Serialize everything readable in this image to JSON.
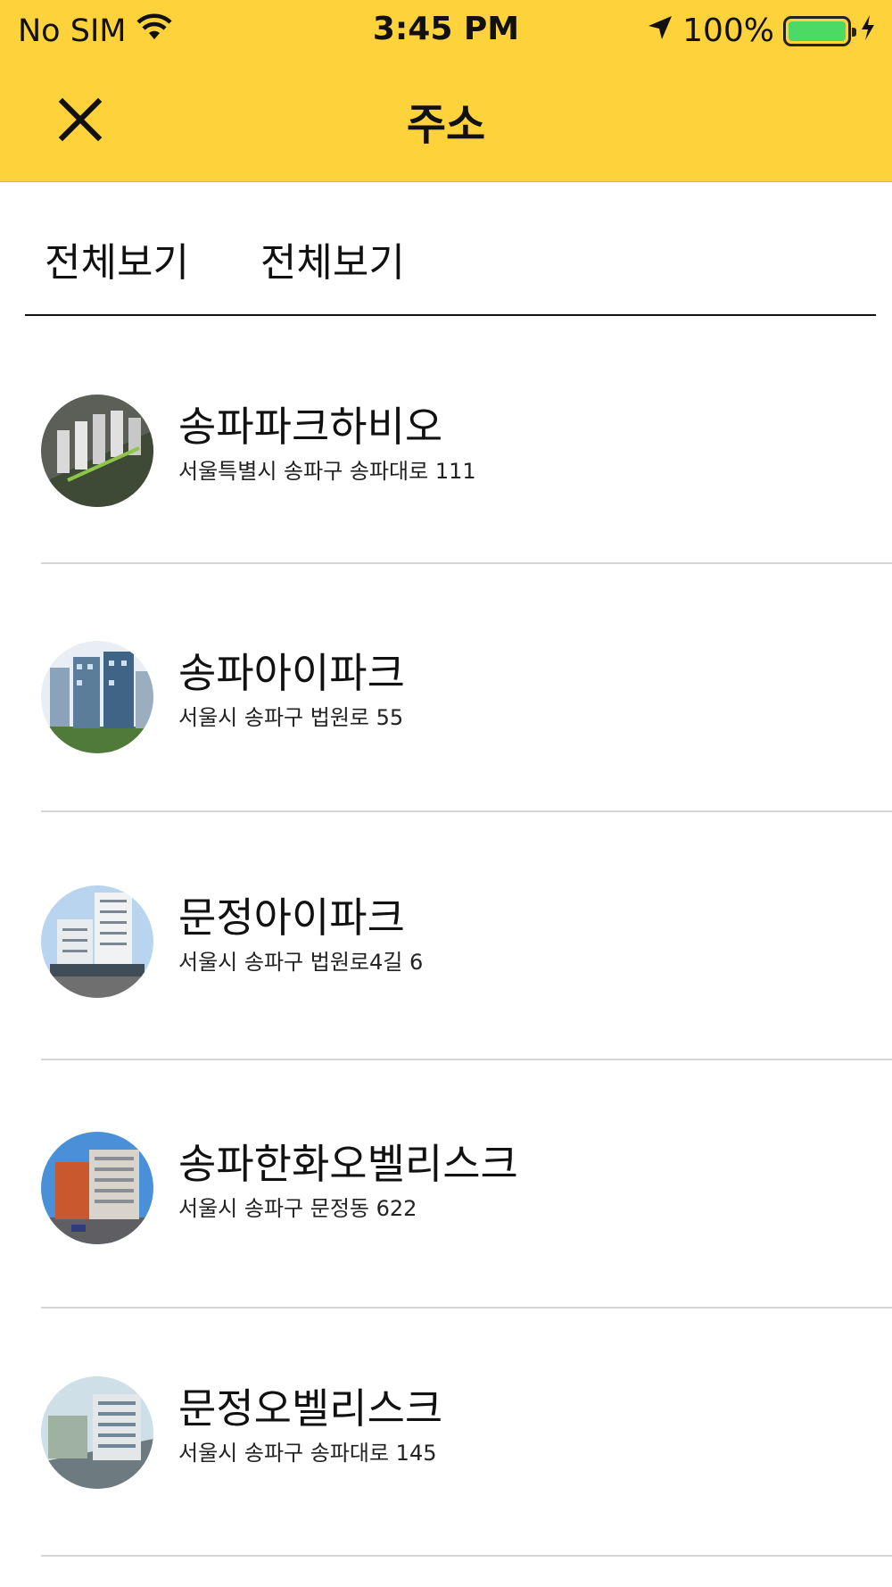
{
  "status_bar": {
    "carrier": "No SIM",
    "time": "3:45 PM",
    "battery": "100%"
  },
  "header": {
    "title": "주소",
    "close_icon": "close-icon"
  },
  "filters": [
    {
      "label": "전체보기"
    },
    {
      "label": "전체보기"
    }
  ],
  "items": [
    {
      "name": "송파파크하비오",
      "address": "서울특별시 송파구 송파대로 111"
    },
    {
      "name": "송파아이파크",
      "address": "서울시 송파구 법원로 55"
    },
    {
      "name": "문정아이파크",
      "address": "서울시 송파구 법원로4길 6"
    },
    {
      "name": "송파한화오벨리스크",
      "address": "서울시 송파구 문정동 622"
    },
    {
      "name": "문정오벨리스크",
      "address": "서울시 송파구 송파대로 145"
    }
  ],
  "colors": {
    "header_bg": "#fed23a",
    "battery_fill": "#4cd964",
    "divider": "#d6d6d6"
  }
}
